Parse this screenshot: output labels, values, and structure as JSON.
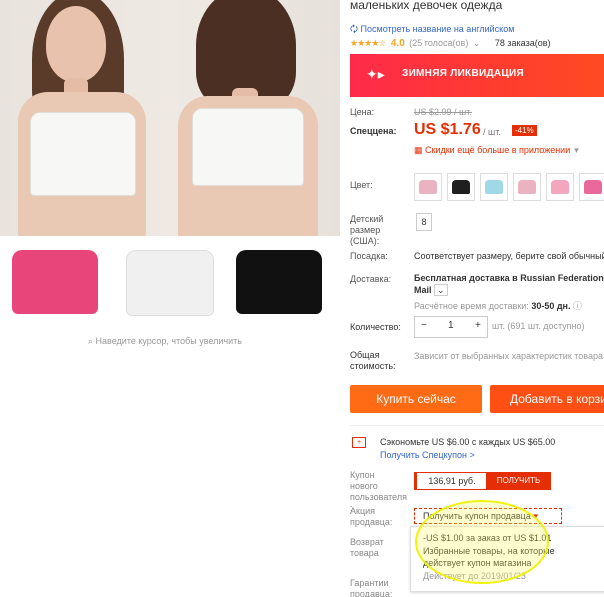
{
  "gallery": {
    "zoom_hint": "Наведите курсор, чтобы увеличить",
    "thumbnail_colors": [
      "#e8467b",
      "#eeeeee",
      "#111111"
    ]
  },
  "product": {
    "title": "маленьких девочек одежда",
    "translate_link": "Посмотреть название на английском",
    "rating": {
      "stars": "★★★★☆",
      "score": "4.0",
      "votes": "(25 голоса(ов)",
      "votes_chevron": "⌄",
      "orders": "78 заказа(ов)"
    },
    "banner_text": "ЗИМНЯЯ ЛИКВИДАЦИЯ",
    "price_label": "Цена:",
    "old_price": "US $2.99 / шт.",
    "special_label": "Спеццена:",
    "price": "US $1.76",
    "per_unit": "/ шт.",
    "discount": "-41%",
    "app_discount": "Скидки ещё больше в приложении",
    "app_chevron": "▾",
    "color_label": "Цвет:",
    "swatch_colors": [
      "#e9b3c2",
      "#1f1f1f",
      "#9fd8e6",
      "#e9b3c2",
      "#f3a6bd",
      "#e8699a"
    ],
    "size_label": "Детский размер (США):",
    "size_value": "8",
    "fit_label": "Посадка:",
    "fit_value": "Соответствует размеру, берите свой обычный",
    "shipping_label": "Доставка:",
    "shipping_value": "Бесплатная доставка в Russian Federation",
    "shipping_method": "Mail",
    "shipping_time_label": "Расчётное время доставки:",
    "shipping_time": "30-50 дн.",
    "qty_label": "Количество:",
    "qty_minus": "−",
    "qty_value": "1",
    "qty_plus": "+",
    "qty_note": "шт. (691 шт. доступно)",
    "total_label": "Общая стоимость:",
    "total_value": "Зависит от выбранных характеристик товара",
    "buy_now": "Купить сейчас",
    "add_to_cart": "Добавить в корзину"
  },
  "coupons": {
    "save_icon": "+",
    "save_text": "Сэкономьте US $6.00 с каждых US $65.00",
    "save_link": "Получить Спецкупон >",
    "new_user_label": "Купон нового пользователя :",
    "new_user_amount": "136,91 руб.",
    "get_button": "ПОЛУЧИТЬ",
    "seller_label": "Акция продавца:",
    "seller_dropdown": "Получить купон продавца",
    "seller_chevron": "▾",
    "return_label": "Возврат товара",
    "guarantee_label": "Гарантии продавца:",
    "popover": {
      "line1": "-US $1.00 за заказ от US $1.01",
      "line2": "Избранные товары, на которые",
      "line3": "действует купон магазина",
      "line4": "Действует до 2019/01/23"
    }
  },
  "colors": {
    "accent": "#e62e04",
    "orange": "#ff6a15",
    "link": "#3366cc",
    "star": "#f5a623",
    "highlight": "#f0f000"
  }
}
